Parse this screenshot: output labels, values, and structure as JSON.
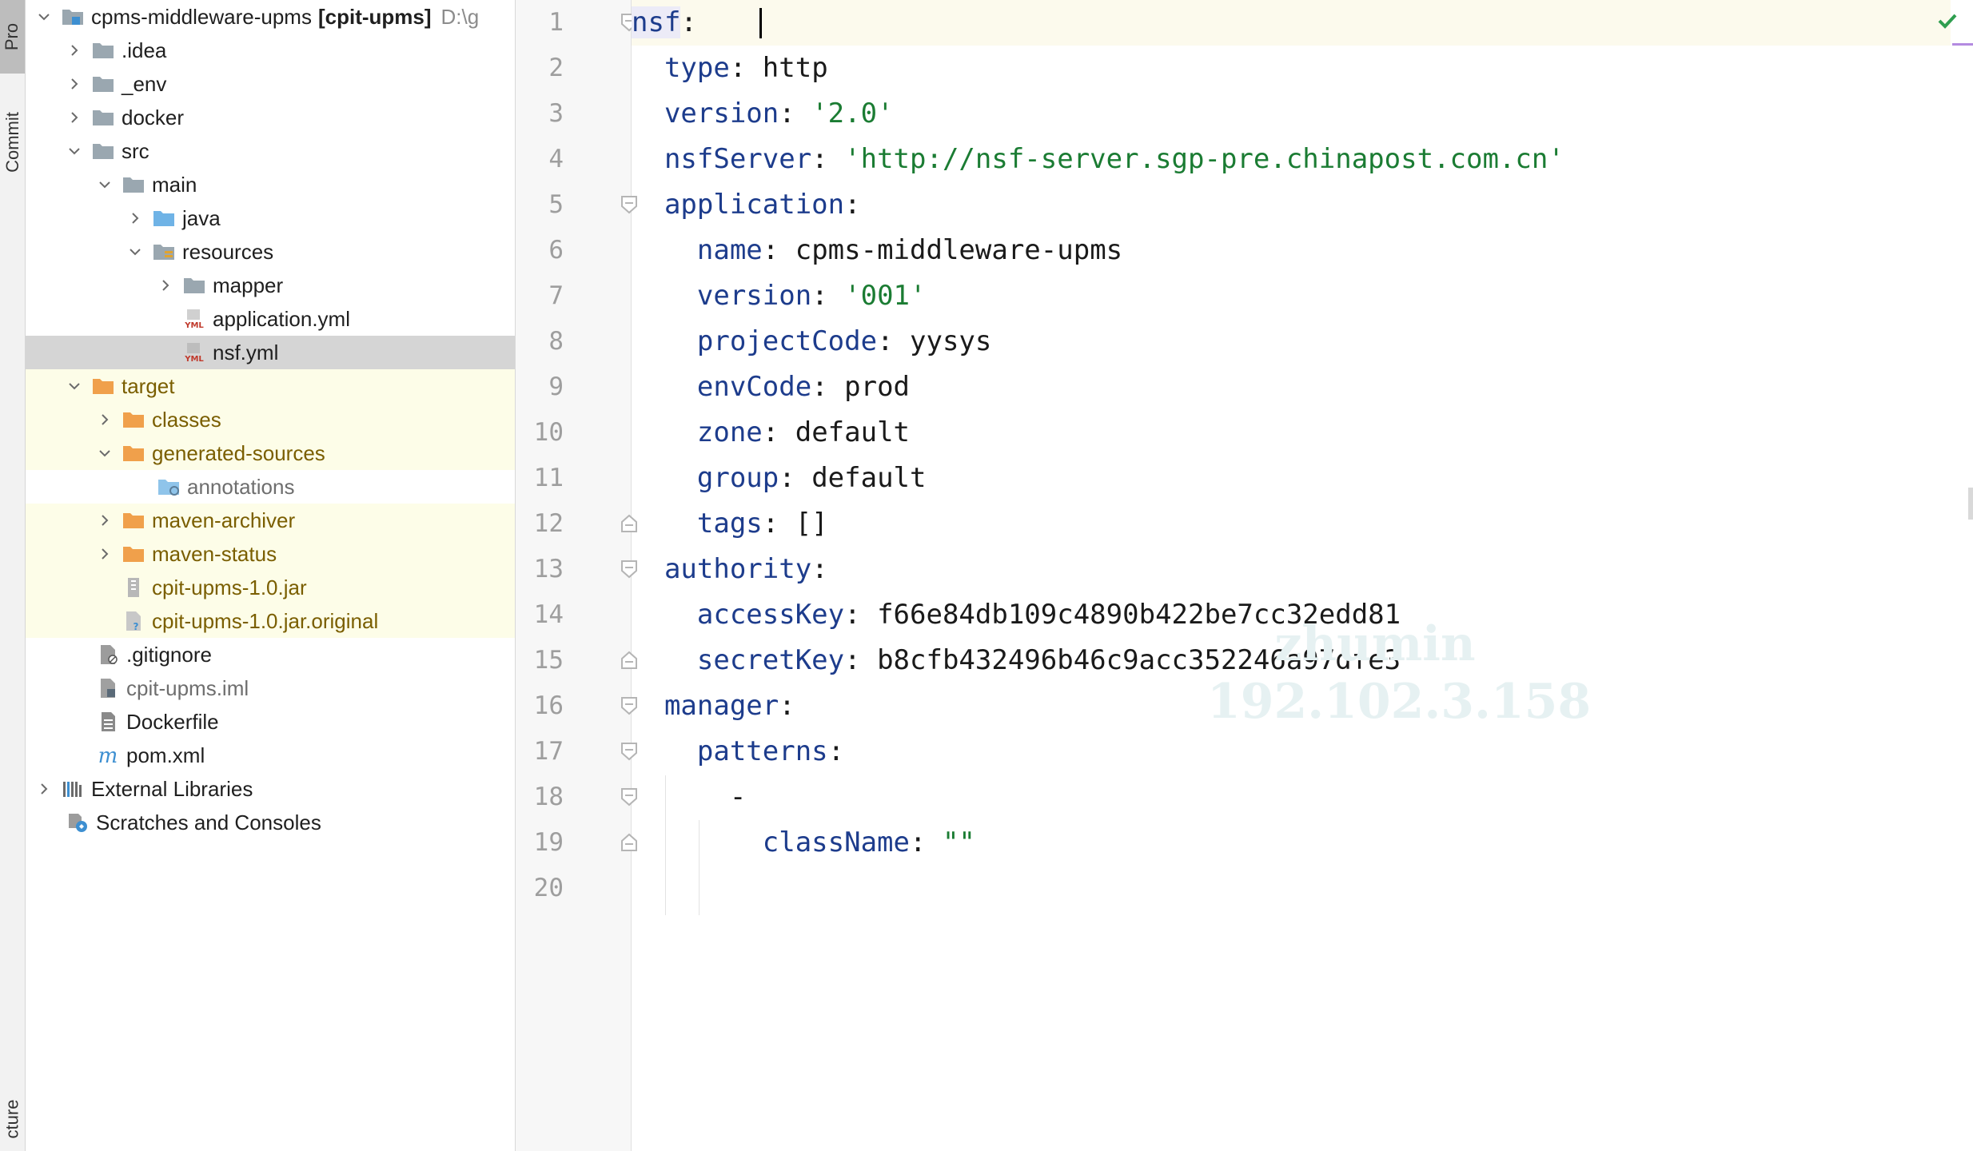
{
  "toolstrip": {
    "project_label": "Pro",
    "commit_label": "Commit",
    "structure_label": "cture"
  },
  "tree": {
    "root": {
      "name": "cpms-middleware-upms",
      "module": "[cpit-upms]",
      "path": "D:\\g"
    },
    "items": [
      {
        "label": ".idea"
      },
      {
        "label": "_env"
      },
      {
        "label": "docker"
      },
      {
        "label": "src"
      },
      {
        "label": "main"
      },
      {
        "label": "java"
      },
      {
        "label": "resources"
      },
      {
        "label": "mapper"
      },
      {
        "label": "application.yml"
      },
      {
        "label": "nsf.yml"
      },
      {
        "label": "target"
      },
      {
        "label": "classes"
      },
      {
        "label": "generated-sources"
      },
      {
        "label": "annotations"
      },
      {
        "label": "maven-archiver"
      },
      {
        "label": "maven-status"
      },
      {
        "label": "cpit-upms-1.0.jar"
      },
      {
        "label": "cpit-upms-1.0.jar.original"
      },
      {
        "label": ".gitignore"
      },
      {
        "label": "cpit-upms.iml"
      },
      {
        "label": "Dockerfile"
      },
      {
        "label": "pom.xml"
      },
      {
        "label": "External Libraries"
      },
      {
        "label": "Scratches and Consoles"
      }
    ]
  },
  "editor": {
    "line_numbers": [
      "1",
      "2",
      "3",
      "4",
      "5",
      "6",
      "7",
      "8",
      "9",
      "10",
      "11",
      "12",
      "13",
      "14",
      "15",
      "16",
      "17",
      "18",
      "19",
      "20"
    ],
    "lines": [
      {
        "key": "nsf",
        "sep": ":",
        "val": ""
      },
      {
        "key": "type",
        "sep": ": ",
        "val": "http"
      },
      {
        "key": "version",
        "sep": ": ",
        "str": "'2.0'"
      },
      {
        "key": "nsfServer",
        "sep": ": ",
        "str": "'http://nsf-server.sgp-pre.chinapost.com.cn'"
      },
      {
        "key": "application",
        "sep": ":",
        "val": ""
      },
      {
        "key": "name",
        "sep": ": ",
        "val": "cpms-middleware-upms"
      },
      {
        "key": "version",
        "sep": ": ",
        "str": "'001'"
      },
      {
        "key": "projectCode",
        "sep": ": ",
        "val": "yysys"
      },
      {
        "key": "envCode",
        "sep": ": ",
        "val": "prod"
      },
      {
        "key": "zone",
        "sep": ": ",
        "val": "default"
      },
      {
        "key": "group",
        "sep": ": ",
        "val": "default"
      },
      {
        "key": "tags",
        "sep": ": ",
        "val": "[]"
      },
      {
        "key": "authority",
        "sep": ":",
        "val": ""
      },
      {
        "key": "accessKey",
        "sep": ": ",
        "val": "f66e84db109c4890b422be7cc32edd81"
      },
      {
        "key": "secretKey",
        "sep": ": ",
        "val": "b8cfb432496b46c9acc352246a97dfe3"
      },
      {
        "key": "manager",
        "sep": ":",
        "val": ""
      },
      {
        "key": "patterns",
        "sep": ":",
        "val": ""
      },
      {
        "key": "",
        "sep": "",
        "val": "-"
      },
      {
        "key": "className",
        "sep": ": ",
        "str": "\"\""
      },
      {
        "key": "",
        "sep": "",
        "val": ""
      }
    ],
    "watermark_line1": "zhumin",
    "watermark_line2": "192.102.3.158"
  },
  "colors": {
    "key": "#1d3c8c",
    "string": "#1b7c33",
    "excluded_bg": "#fdfde8",
    "selected_bg": "#d5d5d5",
    "check": "#2e9e4f"
  }
}
